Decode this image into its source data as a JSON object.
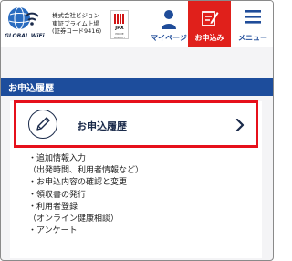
{
  "header": {
    "logo_text": "GLOBAL WiFi",
    "company_lines": [
      "株式会社ビジョン",
      "東証プライム上場",
      "(証券コード9416)"
    ],
    "jpx_label": "JPX",
    "jpx_sub": "PRIME MARKET",
    "nav": {
      "mypage_label": "マイページ",
      "apply_label": "お申込み",
      "menu_label": "メニュー"
    }
  },
  "section": {
    "band_title": "お申込履歴",
    "card_title": "お申込履歴"
  },
  "links": [
    "・追加情報入力",
    "（出発時間、利用者情報など）",
    "・お申込内容の確認と変更",
    "・領収書の発行",
    "・利用者登録",
    "（オンライン健康相談）",
    "・アンケート"
  ],
  "colors": {
    "brand_blue": "#1d4d9c",
    "apply_red": "#e0201b",
    "highlight_red": "#e6101b"
  },
  "icons": {
    "logo": "globe-wifi-icon",
    "mypage": "person-icon",
    "apply": "form-edit-icon",
    "menu": "hamburger-icon",
    "card": "pencil-icon",
    "card_chevron": "chevron-right-icon"
  }
}
